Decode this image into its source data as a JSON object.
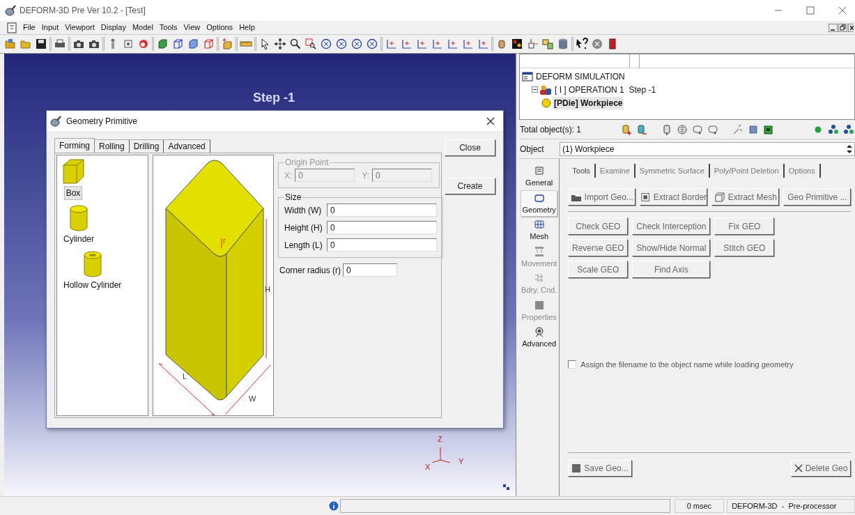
{
  "window": {
    "title": "DEFORM-3D Pre Ver 10.2 - [Test]"
  },
  "menu": [
    "File",
    "Input",
    "Viewport",
    "Display",
    "Model",
    "Tools",
    "View",
    "Options",
    "Help"
  ],
  "viewport": {
    "step_label": "Step -1",
    "axes": {
      "z": "Z",
      "x": "X",
      "y": "Y"
    }
  },
  "dialog": {
    "title": "Geometry Primitive",
    "tabs": [
      {
        "label": "Forming",
        "selected": true
      },
      {
        "label": "Rolling",
        "selected": false
      },
      {
        "label": "Drilling",
        "selected": false
      },
      {
        "label": "Advanced",
        "selected": false
      }
    ],
    "shapes": [
      {
        "label": "Box",
        "kind": "box",
        "selected": true
      },
      {
        "label": "Cylinder",
        "kind": "cylinder",
        "selected": false
      },
      {
        "label": "Hollow Cylinder",
        "kind": "hollow",
        "selected": false
      }
    ],
    "dimension_labels": {
      "r": "r",
      "h": "H",
      "l": "L",
      "w": "W"
    },
    "origin_point": {
      "title": "Origin Point",
      "disabled": true,
      "fields": [
        {
          "label": "X:",
          "value": "0"
        },
        {
          "label": "Y:",
          "value": "0"
        }
      ]
    },
    "size": {
      "title": "Size",
      "fields": [
        {
          "label": "Width (W)",
          "value": "0"
        },
        {
          "label": "Height (H)",
          "value": "0"
        },
        {
          "label": "Length (L)",
          "value": "0"
        }
      ]
    },
    "corner_radius": {
      "label": "Corner radius (r)",
      "value": "0"
    },
    "buttons": [
      "Close",
      "Create"
    ]
  },
  "tree": [
    {
      "label": "DEFORM SIMULATION",
      "kind": "simulation",
      "selected": false,
      "children": [
        {
          "label": "[ I ] OPERATION 1  Step -1",
          "kind": "operation",
          "selected": false,
          "expanded": true,
          "children": [
            {
              "label": "[PDie] Workpiece",
              "kind": "object",
              "selected": true
            }
          ]
        }
      ]
    }
  ],
  "objects_bar": {
    "total": "Total object(s): 1"
  },
  "object_select": {
    "label": "Object",
    "value": "(1) Workpiece"
  },
  "nav": [
    {
      "label": "General",
      "kind": "general",
      "selected": false,
      "disabled": false
    },
    {
      "label": "Geometry",
      "kind": "geometry",
      "selected": true,
      "disabled": false
    },
    {
      "label": "Mesh",
      "kind": "mesh",
      "selected": false,
      "disabled": false
    },
    {
      "label": "Movement",
      "kind": "movement",
      "selected": false,
      "disabled": true
    },
    {
      "label": "Bdry. Cnd.",
      "kind": "boundary",
      "selected": false,
      "disabled": true
    },
    {
      "label": "Properties",
      "kind": "properties",
      "selected": false,
      "disabled": true
    },
    {
      "label": "Advanced",
      "kind": "advanced",
      "selected": false,
      "disabled": false
    }
  ],
  "tabs": [
    {
      "label": "Tools",
      "selected": true
    },
    {
      "label": "Examine",
      "selected": false
    },
    {
      "label": "Symmetric Surface",
      "selected": false
    },
    {
      "label": "Poly/Point Deletion",
      "selected": false
    },
    {
      "label": "Options",
      "selected": false
    }
  ],
  "primary_buttons": [
    {
      "label": "Import Geo...",
      "kind": "import"
    },
    {
      "label": "Extract Border",
      "kind": "border"
    },
    {
      "label": "Extract Mesh",
      "kind": "mesh"
    },
    {
      "label": "Geo Primitive ...",
      "kind": "plain"
    }
  ],
  "geo_buttons": [
    [
      "Check GEO",
      "Check Interception",
      "Fix GEO"
    ],
    [
      "Reverse GEO",
      "Show/Hide Normal",
      "Stitch GEO"
    ],
    [
      "Scale GEO",
      "Find Axis"
    ]
  ],
  "checkbox": {
    "label": "Assign the filename to the object name while loading geometry",
    "checked": false
  },
  "bottom_buttons": [
    {
      "label": "Save Geo...",
      "kind": "save"
    },
    {
      "label": "Delete Geo",
      "kind": "delete"
    }
  ],
  "status_bar": {
    "time": "0 msec",
    "mode": "DEFORM-3D  -  Pre-processor"
  }
}
